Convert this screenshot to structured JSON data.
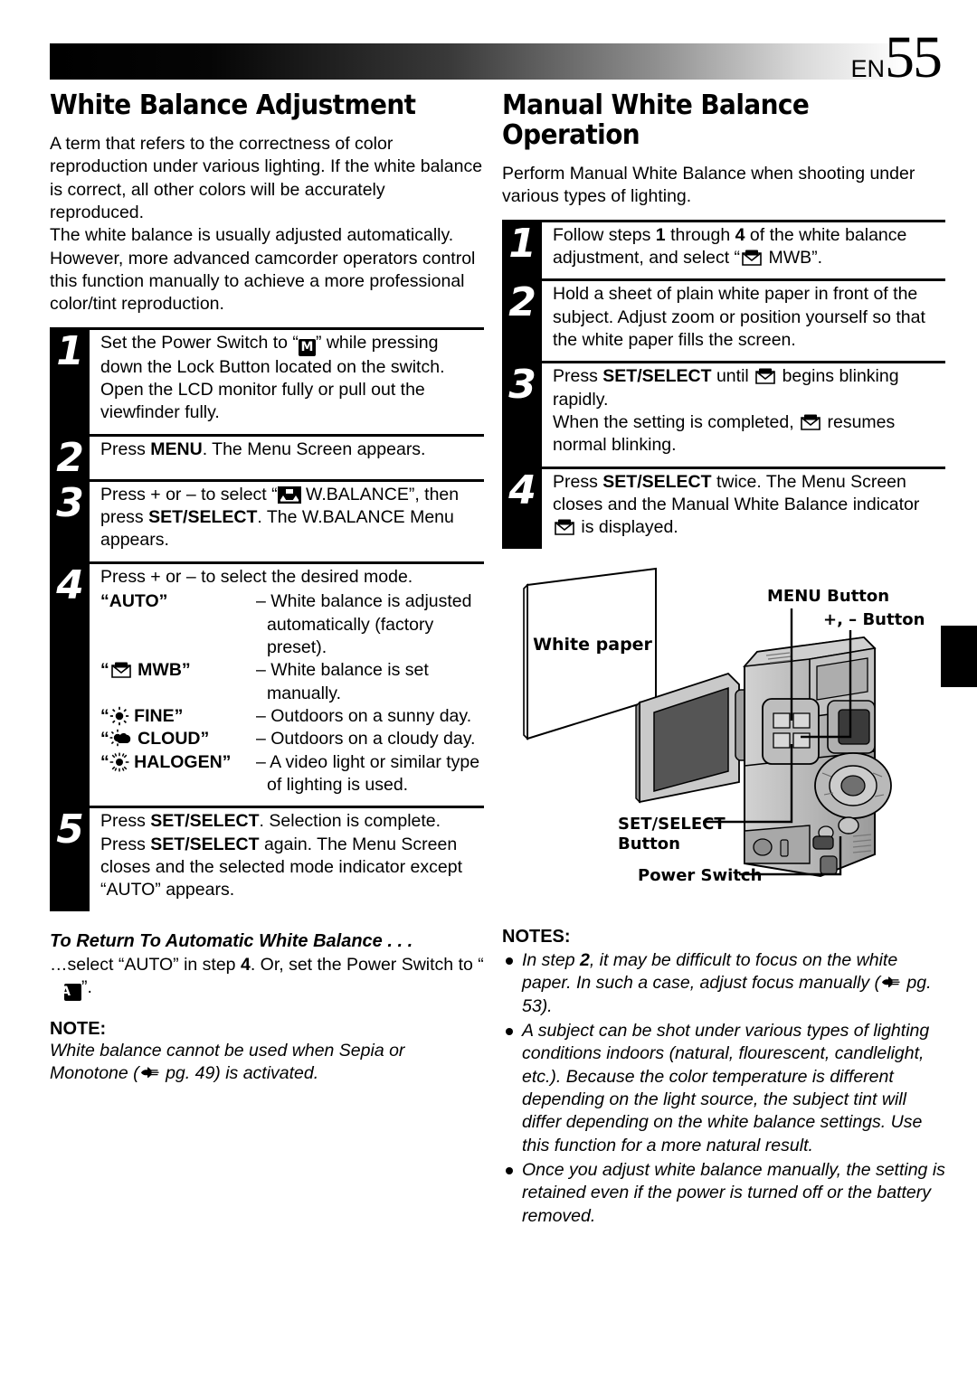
{
  "header": {
    "lang_code": "EN",
    "page_number": "55"
  },
  "left_column": {
    "title": "White Balance Adjustment",
    "intro_paragraph_1": "A term that refers to the correctness of color reproduction under various lighting. If the white balance is correct, all other colors will be accurately reproduced.",
    "intro_paragraph_2": "The white balance is usually adjusted automatically. However, more advanced camcorder operators control this function manually to achieve a more professional color/tint reproduction.",
    "steps": [
      {
        "number": "1",
        "text_before_icon": "Set the Power Switch to “",
        "icon": "power-switch-manual-badge",
        "icon_label": "M",
        "text_after_icon": "” while pressing down the Lock Button located on the switch. Open the LCD monitor fully or pull out the viewfinder fully."
      },
      {
        "number": "2",
        "text_plain": "Press MENU. The Menu Screen appears.",
        "bold_words": [
          "MENU"
        ]
      },
      {
        "number": "3",
        "text_a": "Press + or – to select “",
        "icon": "w-balance-menu-icon",
        "text_b": " W.BALANCE”, then press ",
        "bold": "SET/SELECT",
        "text_c": ". The W.BALANCE Menu appears."
      },
      {
        "number": "4",
        "lead": "Press + or – to select the desired mode."
      },
      {
        "number": "5",
        "text_a": "Press ",
        "bold_1": "SET/SELECT",
        "text_b": ". Selection is complete. Press ",
        "bold_2": "SET/SELECT",
        "text_c": " again. The Menu Screen closes and the selected mode indicator except “AUTO” appears."
      }
    ],
    "modes": [
      {
        "icon": "none",
        "name": "“AUTO”",
        "description": "– White balance is adjusted automatically (factory preset)."
      },
      {
        "icon": "mwb-icon",
        "name": "MWB”",
        "description": "– White balance is set manually."
      },
      {
        "icon": "sun-icon",
        "name": "FINE”",
        "description": "– Outdoors on a sunny day."
      },
      {
        "icon": "cloud-icon",
        "name": "CLOUD”",
        "description": "– Outdoors on a cloudy day."
      },
      {
        "icon": "halogen-icon",
        "name": "HALOGEN”",
        "description": "– A video light or similar type of lighting is used."
      }
    ],
    "return_section": {
      "heading": "To Return To Automatic White Balance . . .",
      "text_a": "…select “AUTO” in step ",
      "step_ref": "4",
      "text_b": ". Or, set the Power Switch to “",
      "icon": "power-switch-auto-badge",
      "icon_label": "A",
      "text_c": "”."
    },
    "note": {
      "label": "NOTE:",
      "text_a": "White balance cannot be used when Sepia or Monotone (",
      "hand_icon": "pointing-hand-icon",
      "text_b": " pg. 49) is activated."
    }
  },
  "right_column": {
    "title": "Manual White Balance Operation",
    "intro_paragraph": "Perform Manual White Balance when shooting under various types of lighting.",
    "steps": [
      {
        "number": "1",
        "text_a": "Follow steps ",
        "bold_1": "1",
        "text_b": " through ",
        "bold_2": "4",
        "text_c": " of the white balance adjustment, and select “",
        "icon": "mwb-icon",
        "text_d": " MWB”."
      },
      {
        "number": "2",
        "text_plain": "Hold a sheet of plain white paper in front of the subject. Adjust zoom or position yourself so that the white paper fills the screen."
      },
      {
        "number": "3",
        "text_a": "Press ",
        "bold_1": "SET/SELECT",
        "text_b": " until ",
        "icon_1": "mwb-icon",
        "text_c": " begins blinking rapidly.",
        "text_d": "When the setting is completed, ",
        "icon_2": "mwb-icon",
        "text_e": " resumes normal blinking."
      },
      {
        "number": "4",
        "text_a": "Press ",
        "bold_1": "SET/SELECT",
        "text_b": " twice. The Menu Screen closes and the Manual White Balance indicator ",
        "icon": "mwb-icon",
        "text_c": " is displayed."
      }
    ],
    "illustration": {
      "labels": {
        "white_paper": "White paper",
        "menu_button": "MENU Button",
        "plus_minus_button": "+, – Button",
        "set_select_button_line1": "SET/SELECT",
        "set_select_button_line2": "Button",
        "power_switch": "Power Switch"
      }
    },
    "notes": {
      "label": "NOTES:",
      "items": [
        "In step 2, it may be difficult to focus on the white paper. In such a case, adjust focus manually (☞ pg. 53).",
        "A subject can be shot under various types of lighting conditions indoors (natural, flourescent, candlelight, etc.). Because the color temperature is different depending on the light source, the subject tint will differ depending on the white balance settings. Use this function for a more natural result.",
        "Once you adjust white balance manually, the setting is retained even if the power is turned off or the battery removed."
      ],
      "item_1_parts": {
        "a": "In step ",
        "bold": "2",
        "b": ", it may be difficult to focus on the white paper. In such a case, adjust focus manually (",
        "hand_icon": "pointing-hand-icon",
        "c": " pg. 53)."
      }
    }
  },
  "colors": {
    "ink": "#000000",
    "paper": "#ffffff",
    "illustration_body": "#b8b8b8",
    "illustration_dark": "#5a5a5a"
  }
}
